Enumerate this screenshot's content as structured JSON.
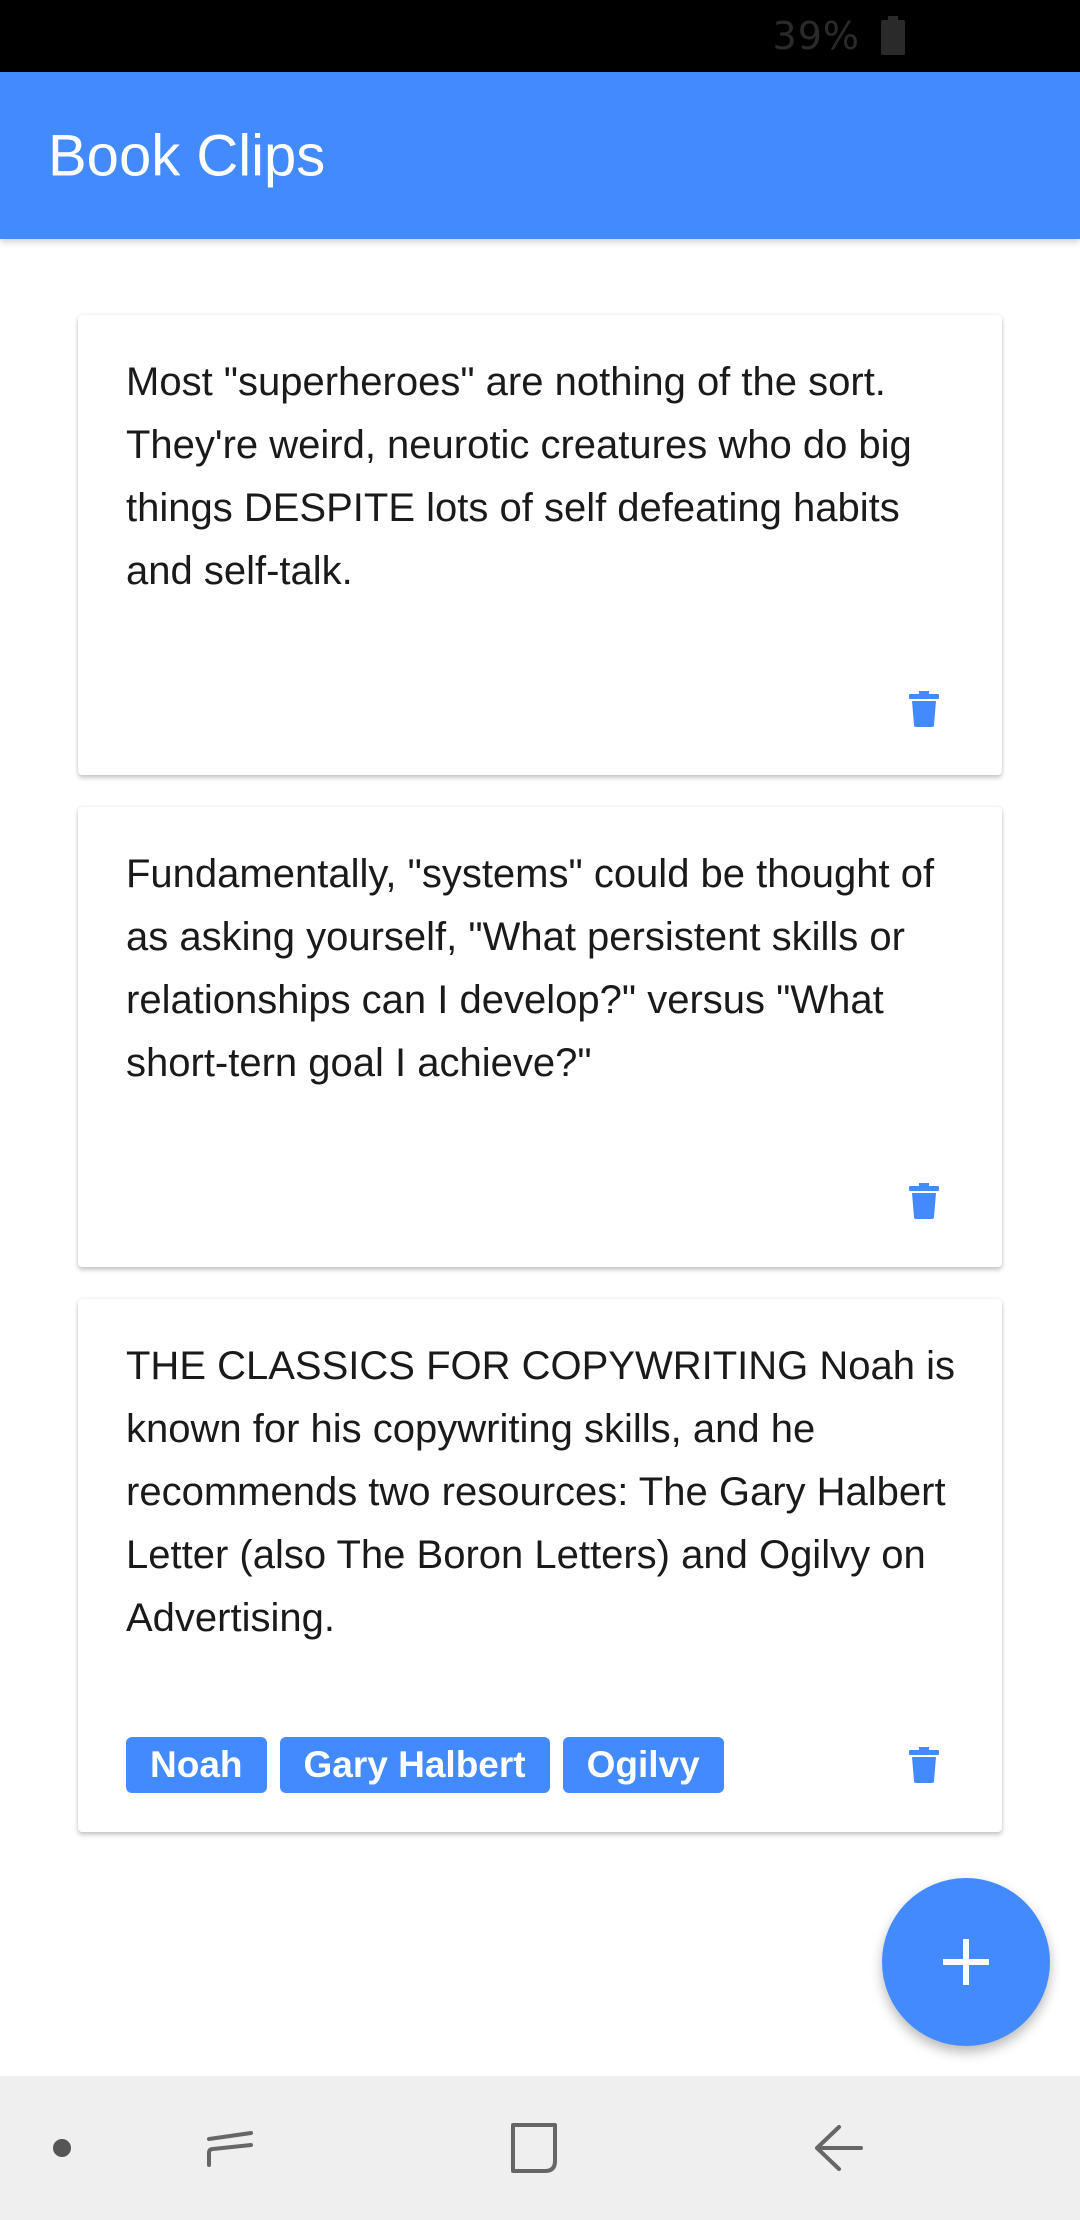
{
  "status_bar": {
    "battery_percent": "39%",
    "battery_icon": "battery-icon"
  },
  "app_bar": {
    "title": "Book Clips"
  },
  "clips": [
    {
      "text": "Most \"superheroes\" are nothing of the sort. They're weird, neurotic creatures who do big things DESPITE lots of self defeating habits and self-talk.",
      "tags": []
    },
    {
      "text": "Fundamentally, \"systems\" could be thought of as asking yourself, \"What persistent skills or relationships can I develop?\" versus \"What short-tern goal I achieve?\"",
      "tags": []
    },
    {
      "text": "THE CLASSICS FOR COPYWRITING Noah is known for his copywriting skills, and he recommends two resources: The Gary Halbert Letter (also The Boron Letters) and Ogilvy on Advertising.",
      "tags": [
        "Noah",
        "Gary Halbert",
        "Ogilvy"
      ]
    }
  ],
  "icons": {
    "delete": "trash-icon",
    "add": "plus-icon",
    "nav_dot": "dot-icon",
    "nav_recents": "recents-icon",
    "nav_home": "home-icon",
    "nav_back": "back-icon"
  },
  "colors": {
    "accent": "#448aff",
    "status_bar": "#000000",
    "nav_bar": "#efefef",
    "text": "#1a1a1a"
  }
}
